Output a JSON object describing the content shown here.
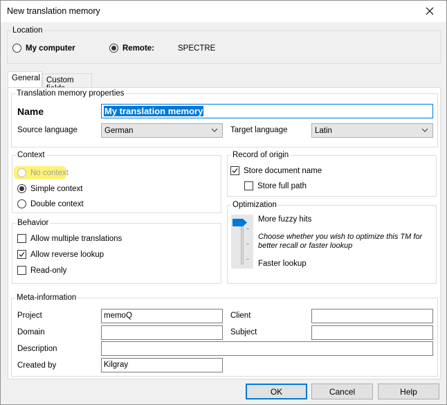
{
  "window": {
    "title": "New translation memory"
  },
  "location": {
    "legend": "Location",
    "my_computer": "My computer",
    "remote": "Remote:",
    "server": "SPECTRE"
  },
  "tabs": [
    {
      "label": "General"
    },
    {
      "label": "Custom fields"
    }
  ],
  "properties": {
    "legend": "Translation memory properties",
    "name_label": "Name",
    "name_value": "My translation memory",
    "source_label": "Source language",
    "source_value": "German",
    "target_label": "Target language",
    "target_value": "Latin"
  },
  "context": {
    "legend": "Context",
    "no_context": "No context",
    "simple_context": "Simple context",
    "double_context": "Double context"
  },
  "origin": {
    "legend": "Record of origin",
    "store_doc": "Store document name",
    "store_path": "Store full path"
  },
  "behavior": {
    "legend": "Behavior",
    "multiple": "Allow multiple translations",
    "reverse": "Allow reverse lookup",
    "readonly": "Read-only"
  },
  "optimization": {
    "legend": "Optimization",
    "top": "More fuzzy hits",
    "desc": "Choose whether you wish to optimize this TM for better recall or faster lookup",
    "bottom": "Faster lookup",
    "slider_level": 1.0
  },
  "meta": {
    "legend": "Meta-information",
    "project_label": "Project",
    "project_value": "memoQ",
    "client_label": "Client",
    "client_value": "",
    "domain_label": "Domain",
    "domain_value": "",
    "subject_label": "Subject",
    "subject_value": "",
    "description_label": "Description",
    "description_value": "",
    "createdby_label": "Created by",
    "createdby_value": "Kilgray"
  },
  "buttons": {
    "ok": "OK",
    "cancel": "Cancel",
    "help": "Help"
  },
  "colors": {
    "accent": "#0078d7",
    "highlight": "#fff176",
    "selection": "#0078d7"
  }
}
